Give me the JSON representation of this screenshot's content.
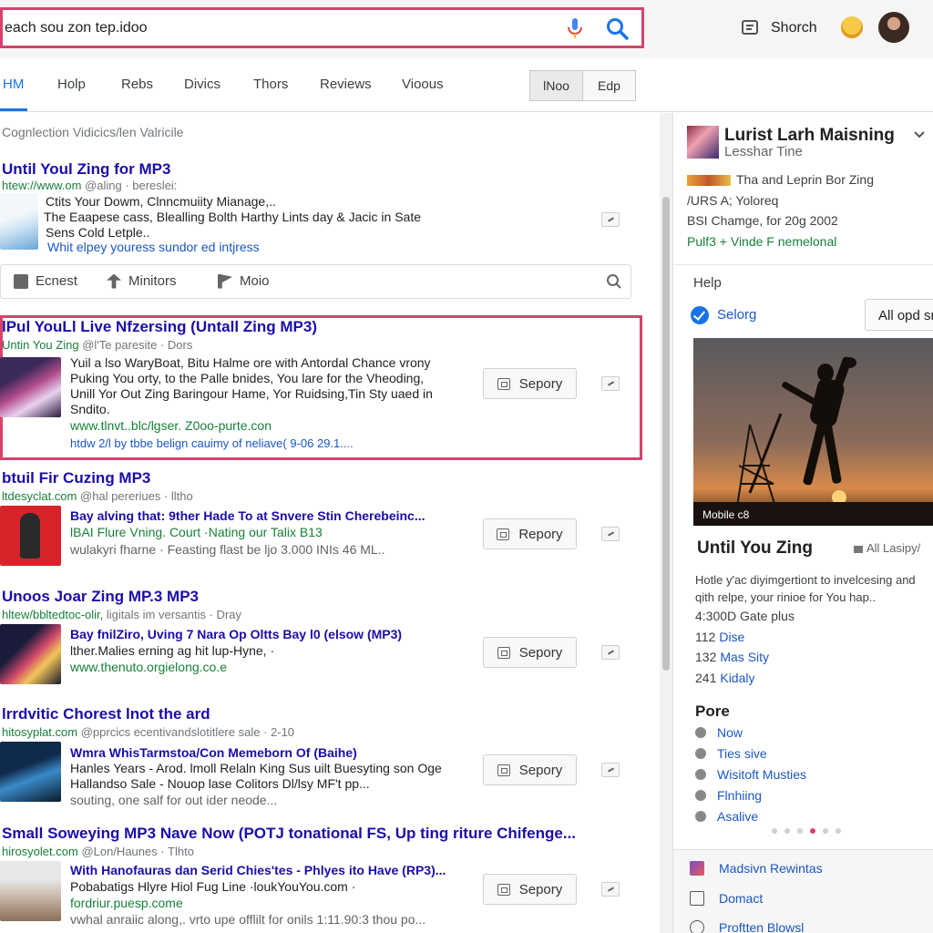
{
  "search": {
    "query": "each sou zon tep.idoo"
  },
  "header": {
    "user_label": "Shorch"
  },
  "tabs": [
    {
      "label": "HM",
      "active": true
    },
    {
      "label": "Holp"
    },
    {
      "label": "Rebs"
    },
    {
      "label": "Divics"
    },
    {
      "label": "Thors"
    },
    {
      "label": "Reviews"
    },
    {
      "label": "Vioous"
    }
  ],
  "segment": {
    "left": "lNoo",
    "right": "Edp"
  },
  "results": {
    "section_label": "Cognlection Vidicics/len Valricile",
    "r1": {
      "title": "Until Youl Zing for MP3",
      "url": "htew://www.om",
      "url_meta": "@aling · bereslei:",
      "lines": [
        "Ctits Your Dowm, Clnncmuiity Mianage,..",
        "The Eaapese cass, Blealling Bolth Harthy Lints day & Jacic in Sate",
        "Sens Cold Letple..",
        "Whit elpey youress sundor ed intjress"
      ]
    },
    "toolbar": {
      "item1": "Ecnest",
      "item2": "Minitors",
      "item3": "Moio"
    },
    "r2": {
      "title": "lPul YouLl Live Nfzersing (Untall Zing MP3)",
      "url": "Untin You Zing",
      "url_meta": "@l'Te paresite · Dors",
      "lines": [
        "Yuil a lso WaryBoat, Bitu Halme ore with Antordal Chance vrony",
        "Puking You orty, to the Palle bnides, You lare for the Vheoding,",
        "Unill Yor Out Zing Baringour Hame, Yor Ruidsing,Tin Sty uaed in",
        "Sndito."
      ],
      "green": "www.tlnvt..blc/lgser. Z0oo-purte.con",
      "foot": "htdw 2/l by tbbe belign cauimy of neliave( 9-06 29.1....",
      "button": "Sepory"
    },
    "r3": {
      "title": "btuil Fir Cuzing MP3",
      "url": "ltdesyclat.com",
      "url_meta": "@hal pereriues · lltho",
      "blue": "Bay alving that: 9ther Hade To at Snvere Stin Cherebeinc...",
      "green": "lBAI Flure Vning. Court ·Nating our Talix B13",
      "grey": "wulakyri fharne · Feasting flast be ljo 3.000 INIs 46 ML..",
      "button": "Repory"
    },
    "r4": {
      "title": "Unoos Joar Zing MP.3 MP3",
      "url": "hltew/bbltedtoc-olir,",
      "url_meta": "ligitals im versantis · Dray",
      "blue": "Bay fnilZiro, Uving 7 Nara Op Oltts Bay l0 (elsow (MP3)",
      "line": "lther.Malies erning ag hit lup-Hyne, ·",
      "green": "www.thenuto.orgielong.co.e",
      "button": "Sepory"
    },
    "r5": {
      "title": "lrrdvitic Chorest lnot the ard",
      "url": "hitosyplat.com",
      "url_meta": "@pprcics ecentivandslotitlere sale · 2-10",
      "blue": "Wmra WhisTarmstoa/Con Memeborn Of (Baihe)",
      "lines": [
        "Hanles Years - Arod. lmoll Relaln King Sus uilt Buesyting son Oge",
        "Hallandso Sale - Nouop lase Colitors Dl/lsy MF't pp..."
      ],
      "grey": "souting, one salf for out ider neode...",
      "button": "Sepory"
    },
    "r6": {
      "title": "Small Soweying  MP3 Nave Now (POTJ tonational FS, Up ting riture Chifenge...",
      "url": "hirosyolet.com",
      "url_meta": "@Lon/Haunes · Tlhto",
      "blue": "With Hanofauras dan Serid Chies'tes - Phlyes ito Have (RP3)...",
      "line": "Pobabatigs Hlyre Hiol Fug Line ·loukYouYou.com ·",
      "green": "fordriur.puesp.come",
      "grey": "vwhal anraiic along,. vrto upe offlilt for onils 1:11.90:3 thou po...",
      "button": "Sepory"
    }
  },
  "panel": {
    "title": "Lurist Larh Maisning",
    "subtitle": "Lesshar Tine",
    "lines": [
      "Tha and Leprin Bor Zing",
      "/URS A; Yoloreq",
      "BSI Chamge, for 20g 2002",
      "Pulf3 + Vinde F nemelonal"
    ],
    "help": "Help",
    "selorg": "Selorg",
    "all_button": "All opd sr",
    "image_caption": "Mobile c8",
    "card_title": "Until You Zing",
    "card_aside": "All Lasipy/",
    "card_desc": "Hotle y'ac diyimgertiont to invelcesing and qith relpe, your rinioe for You hap..",
    "stats": [
      {
        "text": "4:300D Gate plus",
        "value": ""
      },
      {
        "text": "112",
        "value": "Dise"
      },
      {
        "text": "132",
        "value": "Mas Sity"
      },
      {
        "text": "241",
        "value": "Kidaly"
      }
    ],
    "pore_heading": "Pore",
    "options": [
      "Now",
      "Ties sive",
      "Wisitoft Musties",
      "Flnhiing",
      "Asalive"
    ],
    "footer": [
      "Madsivn Rewintas",
      "Domact",
      "Proftten Blowsl"
    ]
  }
}
